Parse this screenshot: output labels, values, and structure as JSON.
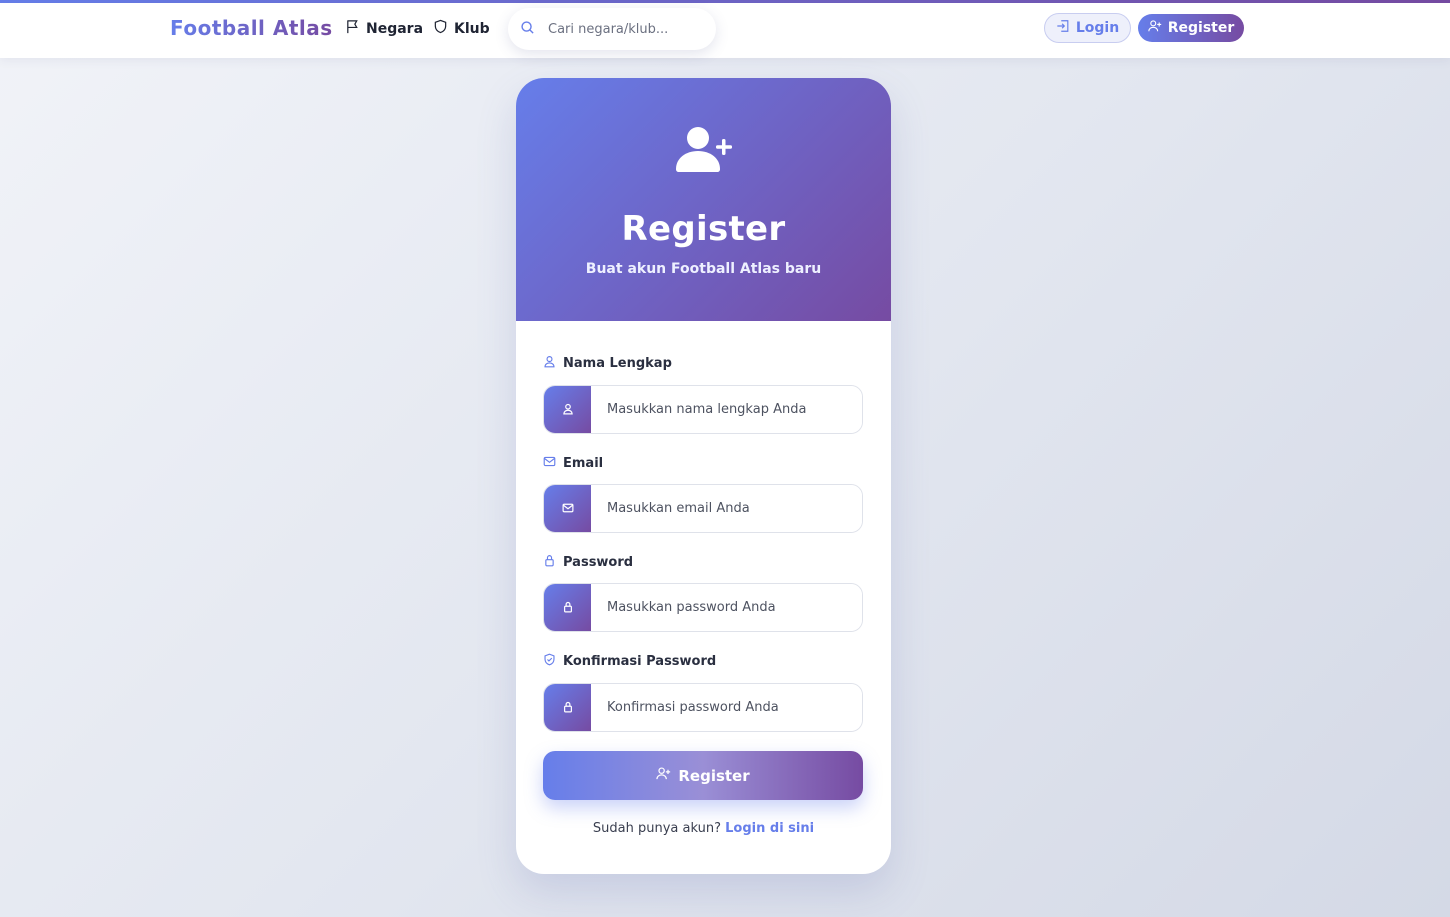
{
  "navbar": {
    "brand": "Football Atlas",
    "links": [
      {
        "label": "Negara",
        "icon": "flag-icon"
      },
      {
        "label": "Klub",
        "icon": "shield-icon"
      }
    ],
    "search": {
      "placeholder": "Cari negara/klub...",
      "icon": "search-icon"
    },
    "login_label": "Login",
    "register_label": "Register"
  },
  "card": {
    "header_icon": "user-plus-icon",
    "title": "Register",
    "subtitle": "Buat akun Football Atlas baru",
    "fields": [
      {
        "label": "Nama Lengkap",
        "placeholder": "Masukkan nama lengkap Anda",
        "label_icon": "user-icon",
        "addon_icon": "user-icon"
      },
      {
        "label": "Email",
        "placeholder": "Masukkan email Anda",
        "label_icon": "envelope-icon",
        "addon_icon": "envelope-icon"
      },
      {
        "label": "Password",
        "placeholder": "Masukkan password Anda",
        "label_icon": "lock-icon",
        "addon_icon": "lock-icon"
      },
      {
        "label": "Konfirmasi Password",
        "placeholder": "Konfirmasi password Anda",
        "label_icon": "shield-check-icon",
        "addon_icon": "lock-icon"
      }
    ],
    "submit_label": "Register",
    "footer_text": "Sudah punya akun?",
    "footer_link": "Login di sini"
  },
  "colors": {
    "accent_start": "#667eea",
    "accent_end": "#764ba2"
  }
}
